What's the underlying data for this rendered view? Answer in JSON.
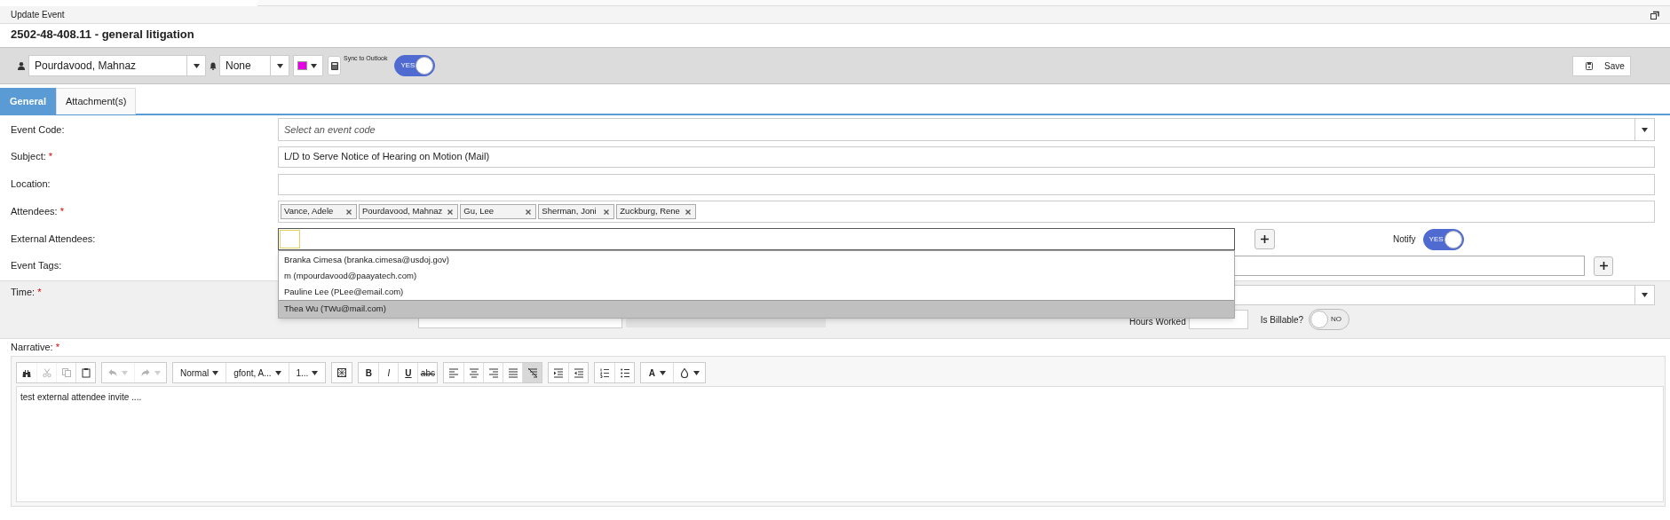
{
  "window": {
    "title": "Update Event"
  },
  "title": "2502-48-408.11 - general litigation",
  "toolbar": {
    "owner": "Pourdavood, Mahnaz",
    "reminder": "None",
    "color": "#e600e6",
    "sync_label": "Sync to Outlook",
    "sync": {
      "on": true,
      "label": "YES"
    },
    "save": "Save"
  },
  "tabs": [
    {
      "label": "General",
      "selected": true
    },
    {
      "label": "Attachment(s)",
      "selected": false
    }
  ],
  "form": [
    {
      "kind": "select",
      "label": "Event Code:",
      "placeholder": "Select an event code"
    },
    {
      "kind": "text",
      "label": "Subject:",
      "mark": "*",
      "value": "L/D to Serve Notice of Hearing on Motion (Mail)"
    },
    {
      "kind": "text",
      "label": "Location:"
    },
    {
      "kind": "chips",
      "label": "Attendees:",
      "mark": "*",
      "chips": [
        "Vance, Adele",
        "Pourdavood, Mahnaz",
        "Gu, Lee",
        "Sherman, Joni",
        "Zuckburg, Rene"
      ]
    },
    {
      "kind": "external",
      "label": "External Attendees:",
      "notify_label": "Notify",
      "notify": {
        "on": true,
        "label": "YES"
      },
      "suggestions": [
        {
          "text": "Branka Cimesa (branka.cimesa@usdoj.gov)",
          "selected": false
        },
        {
          "text": "m (mpourdavood@paayatech.com)",
          "selected": false
        },
        {
          "text": "Pauline Lee (PLee@email.com)",
          "selected": false
        },
        {
          "text": "Thea Wu (TWu@mail.com)",
          "selected": true
        }
      ]
    },
    {
      "kind": "tags",
      "label": "Event Tags:"
    }
  ],
  "time": {
    "label": "Time:",
    "mark": "*",
    "hours_label": "Hours Worked",
    "billable_label": "Is Billable?",
    "billable": {
      "on": false,
      "label": "NO"
    }
  },
  "narrative": {
    "label": "Narrative:",
    "mark": "*",
    "text": "test external attendee invite ....",
    "toolbar": [
      [
        {
          "kind": "find",
          "disabled": false,
          "active": false
        },
        {
          "kind": "cut",
          "disabled": true,
          "active": false
        },
        {
          "kind": "copy",
          "disabled": true,
          "active": false
        },
        {
          "kind": "paste",
          "disabled": false,
          "active": false
        }
      ],
      [
        {
          "kind": "undo",
          "disabled": true,
          "active": false
        },
        {
          "kind": "redo",
          "disabled": true,
          "active": false
        }
      ],
      [
        {
          "kind": "select",
          "label": "Normal",
          "disabled": false,
          "active": false
        },
        {
          "kind": "select",
          "label": "gfont, A...",
          "disabled": false,
          "active": false
        },
        {
          "kind": "select",
          "label": "1...",
          "disabled": false,
          "active": false
        }
      ],
      [
        {
          "kind": "source",
          "disabled": false,
          "active": false
        }
      ],
      [
        {
          "kind": "bold",
          "label": "B",
          "disabled": false,
          "active": false
        },
        {
          "kind": "italic",
          "label": "I",
          "disabled": false,
          "active": false
        },
        {
          "kind": "underline",
          "label": "U",
          "disabled": false,
          "active": false
        },
        {
          "kind": "strike",
          "label": "abc",
          "disabled": false,
          "active": false
        }
      ],
      [
        {
          "kind": "align-left",
          "disabled": false,
          "active": false
        },
        {
          "kind": "align-center",
          "disabled": false,
          "active": false
        },
        {
          "kind": "align-right",
          "disabled": false,
          "active": false
        },
        {
          "kind": "justify",
          "disabled": false,
          "active": false
        },
        {
          "kind": "remove-format",
          "disabled": false,
          "active": true
        }
      ],
      [
        {
          "kind": "indent",
          "disabled": false,
          "active": false
        },
        {
          "kind": "outdent",
          "disabled": false,
          "active": false
        }
      ],
      [
        {
          "kind": "ordered-list",
          "disabled": false,
          "active": false
        },
        {
          "kind": "bullet-list",
          "disabled": false,
          "active": false
        }
      ],
      [
        {
          "kind": "text-color",
          "label": "A",
          "disabled": false,
          "active": false
        },
        {
          "kind": "bg-color",
          "disabled": false,
          "active": false
        }
      ]
    ]
  }
}
